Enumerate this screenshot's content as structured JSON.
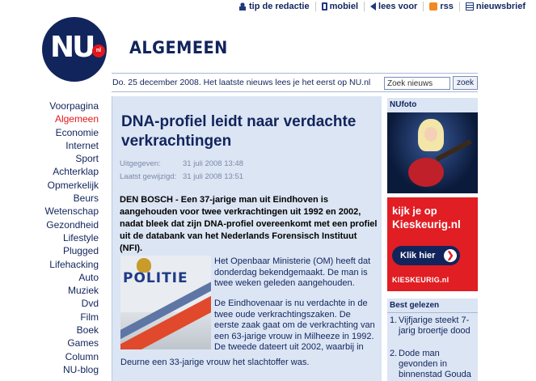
{
  "top_links": [
    {
      "label": "tip de redactie",
      "icon": "person-icon"
    },
    {
      "label": "mobiel",
      "icon": "phone-icon"
    },
    {
      "label": "lees voor",
      "icon": "speaker-icon"
    },
    {
      "label": "rss",
      "icon": "rss-icon"
    },
    {
      "label": "nieuwsbrief",
      "icon": "newsletter-icon"
    }
  ],
  "logo": {
    "text": "NU",
    "badge": "nl"
  },
  "section_title": "ALGEMEEN",
  "date_bar": {
    "text": "Do. 25 december 2008. Het laatste nieuws lees je het eerst op NU.nl",
    "search_placeholder": "Zoek nieuws",
    "search_button": "zoek"
  },
  "nav": {
    "items": [
      "Voorpagina",
      "Algemeen",
      "Economie",
      "Internet",
      "Sport",
      "Achterklap",
      "Opmerkelijk",
      "Beurs",
      "Wetenschap",
      "Gezondheid",
      "Lifestyle",
      "Plugged",
      "Lifehacking",
      "Auto",
      "Muziek",
      "Dvd",
      "Film",
      "Boek",
      "Games",
      "Column",
      "NU-blog"
    ],
    "active": "Algemeen"
  },
  "article": {
    "headline": "DNA-profiel leidt naar verdachte verkrachtingen",
    "published_label": "Uitgegeven:",
    "published_value": "31 juli 2008 13:48",
    "modified_label": "Laatst gewijzigd:",
    "modified_value": "31 juli 2008 13:51",
    "lead": "DEN BOSCH - Een 37-jarige man uit Eindhoven is aangehouden voor twee verkrachtingen uit 1992 en 2002, nadat bleek dat zijn DNA-profiel overeenkomt met een profiel uit de databank van het Nederlands Forensisch Instituut (NFI).",
    "photo_text": "POLITIE",
    "body": [
      "Het Openbaar Ministerie (OM) heeft dat donderdag bekendgemaakt. De man is twee weken geleden aangehouden.",
      "De Eindhovenaar is nu verdachte in de twee oude verkrachtingszaken. De eerste zaak gaat om de verkrachting van een 63-jarige vrouw in Milheeze in 1992. De tweede dateert uit 2002, waarbij in",
      "Deurne een 33-jarige vrouw het slachtoffer was."
    ]
  },
  "nufoto": {
    "title": "NUfoto"
  },
  "ad": {
    "line1": "kijk je op",
    "line2": "Kieskeurig.nl",
    "button": "Klik hier",
    "brand": "KIESKEURIG.nl",
    "color": "#e01e24"
  },
  "best_gelezen": {
    "title": "Best gelezen",
    "items": [
      {
        "num": "1.",
        "text": "Vijfjarige steekt 7-jarig broertje dood"
      },
      {
        "num": "2.",
        "text": "Dode man gevonden in binnenstad Gouda"
      }
    ]
  },
  "colors": {
    "brand_navy": "#12245c",
    "accent_red": "#e3171b",
    "panel_blue": "#dbe5f4"
  }
}
